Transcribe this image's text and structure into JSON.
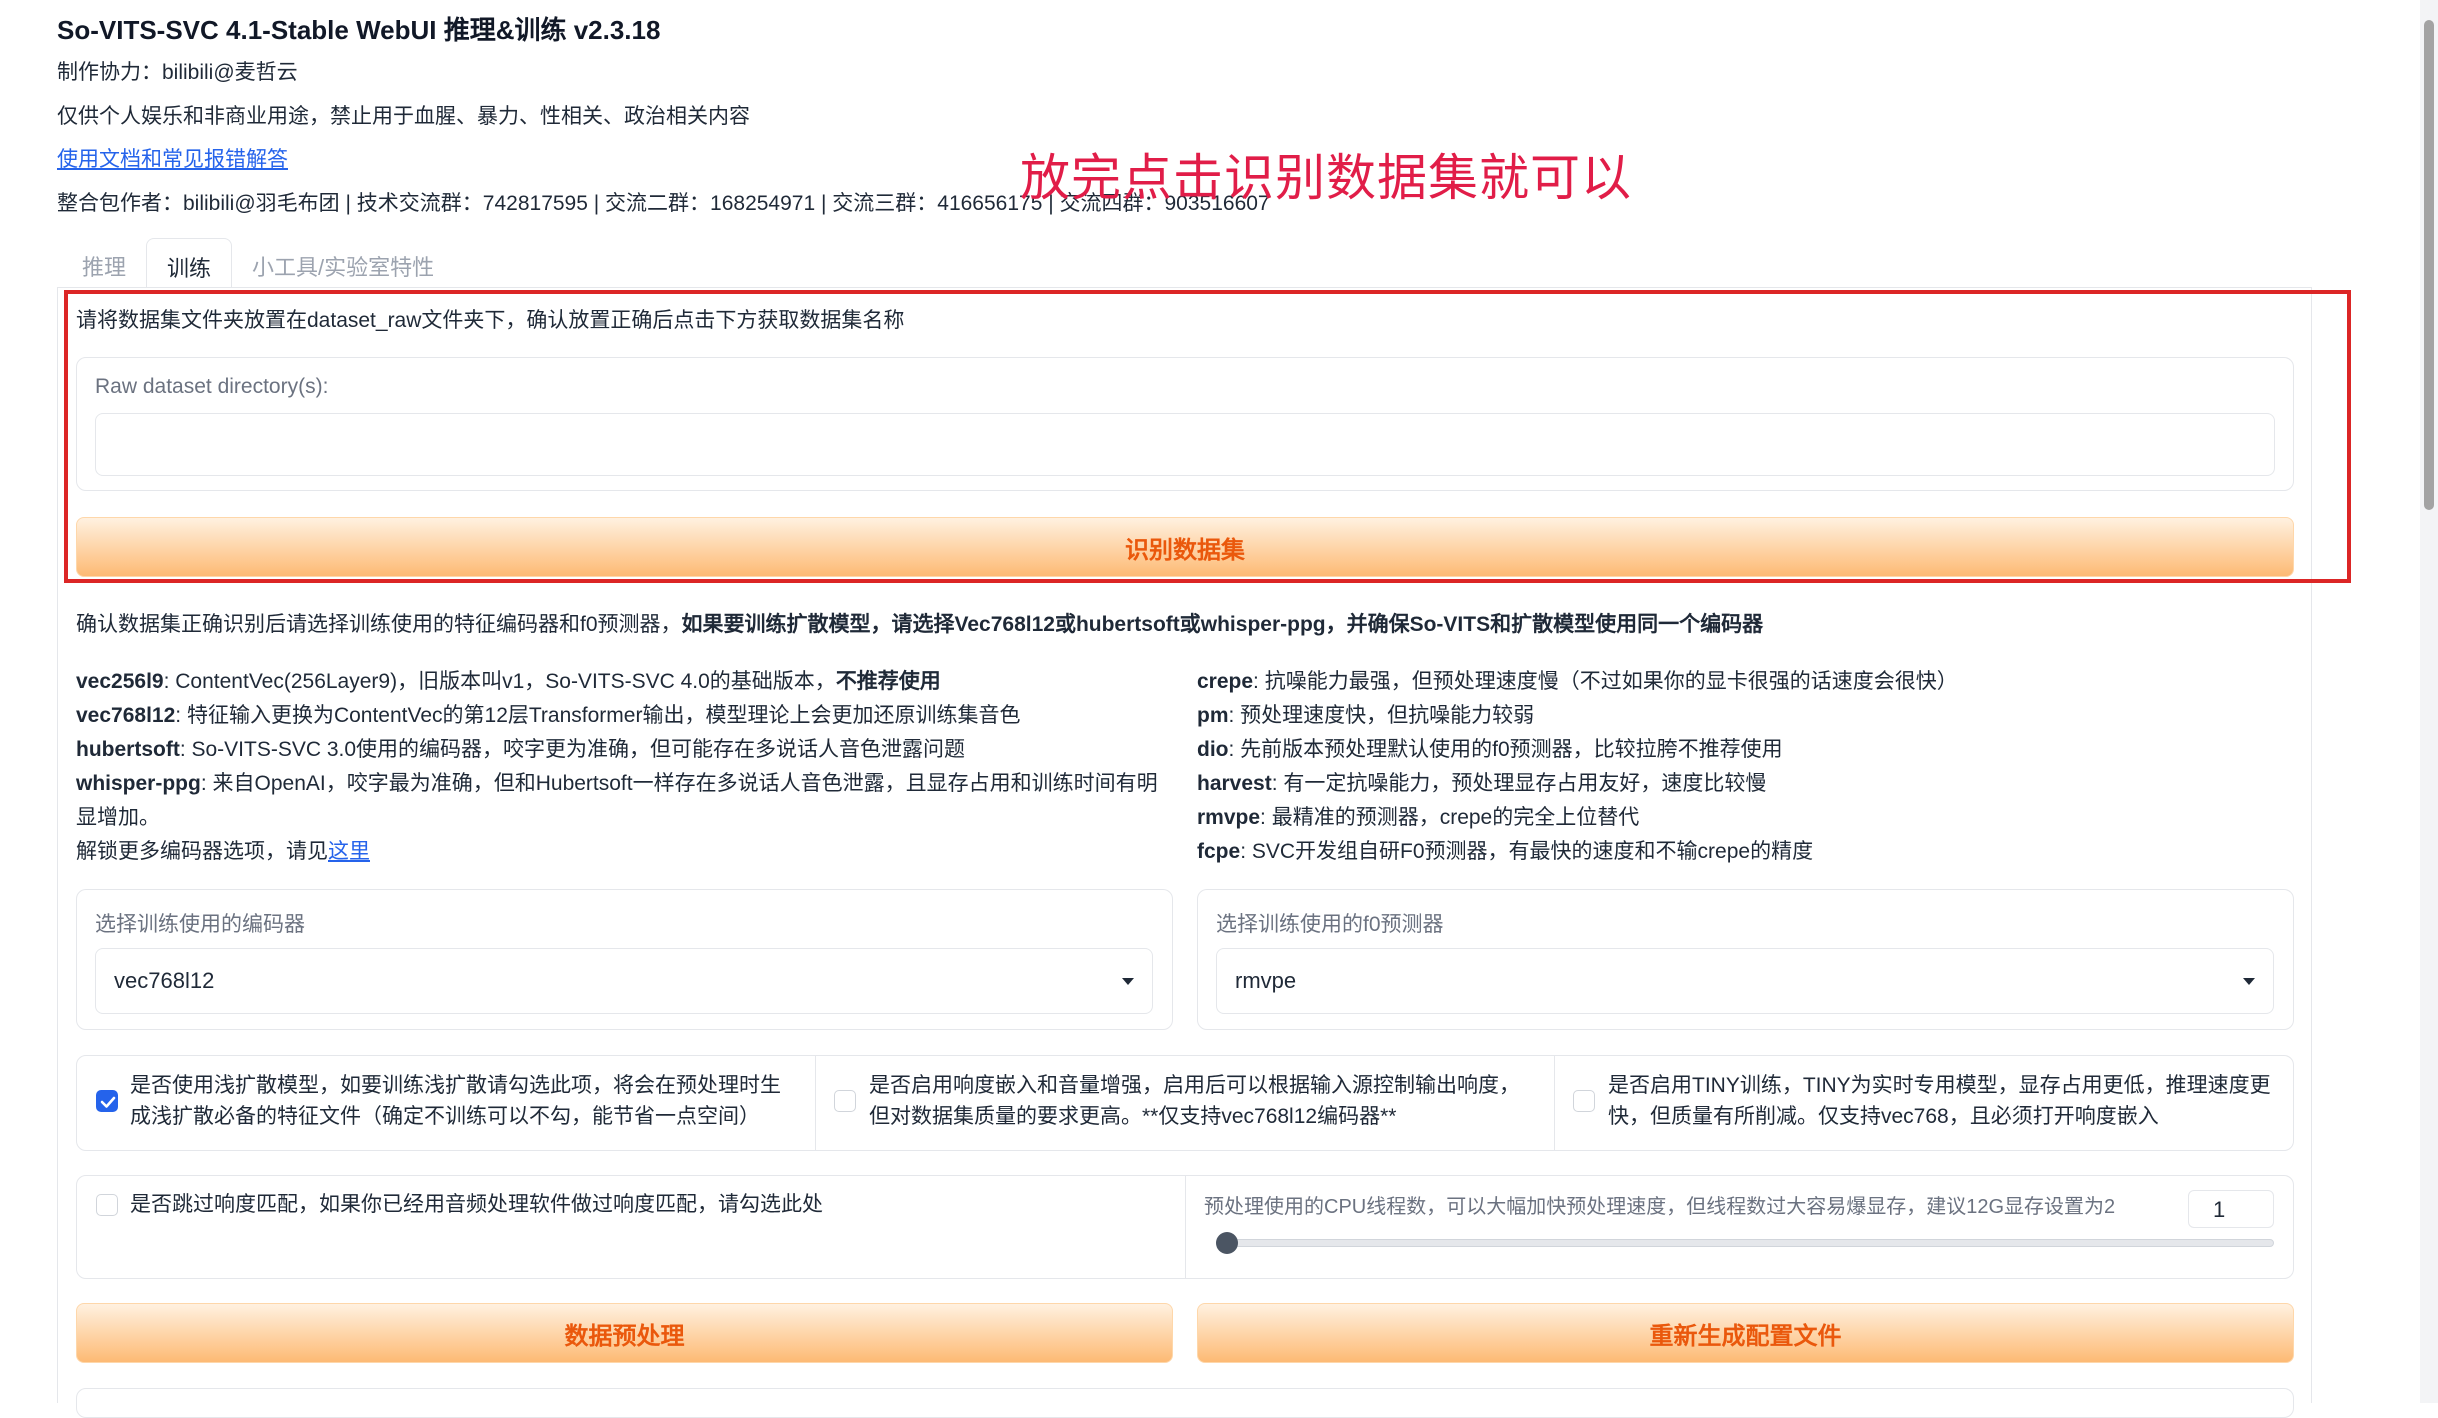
{
  "header": {
    "title": "So-VITS-SVC 4.1-Stable WebUI 推理&训练 v2.3.18",
    "credit": "制作协力：bilibili@麦哲云",
    "notice": "仅供个人娱乐和非商业用途，禁止用于血腥、暴力、性相关、政治相关内容",
    "docs_link": "使用文档和常见报错解答",
    "authors": "整合包作者：bilibili@羽毛布团 | 技术交流群：742817595 | 交流二群：168254971 | 交流三群：416656175 | 交流四群：903516607"
  },
  "annotation": "放完点击识别数据集就可以",
  "tabs": [
    {
      "label": "推理"
    },
    {
      "label": "训练"
    },
    {
      "label": "小工具/实验室特性"
    }
  ],
  "dataset": {
    "instruction": "请将数据集文件夹放置在dataset_raw文件夹下，确认放置正确后点击下方获取数据集名称",
    "raw_label": "Raw dataset directory(s):",
    "raw_value": "",
    "identify_button": "识别数据集"
  },
  "encoder_intro": {
    "normal": "确认数据集正确识别后请选择训练使用的特征编码器和f0预测器，",
    "bold": "如果要训练扩散模型，请选择Vec768l12或hubertsoft或whisper-ppg，并确保So-VITS和扩散模型使用同一个编码器"
  },
  "encoders": [
    {
      "name": "vec256l9",
      "desc": ": ContentVec(256Layer9)，旧版本叫v1，So-VITS-SVC 4.0的基础版本，",
      "strong": "不推荐使用"
    },
    {
      "name": "vec768l12",
      "desc": ": 特征输入更换为ContentVec的第12层Transformer输出，模型理论上会更加还原训练集音色",
      "strong": ""
    },
    {
      "name": "hubertsoft",
      "desc": ": So-VITS-SVC 3.0使用的编码器，咬字更为准确，但可能存在多说话人音色泄露问题",
      "strong": ""
    },
    {
      "name": "whisper-ppg",
      "desc": ": 来自OpenAI，咬字最为准确，但和Hubertsoft一样存在多说话人音色泄露，且显存占用和训练时间有明显增加。",
      "strong": ""
    }
  ],
  "unlock_text": "解锁更多编码器选项，请见",
  "unlock_link": "这里",
  "f0_predictors": [
    {
      "name": "crepe",
      "desc": ": 抗噪能力最强，但预处理速度慢（不过如果你的显卡很强的话速度会很快）"
    },
    {
      "name": "pm",
      "desc": ": 预处理速度快，但抗噪能力较弱"
    },
    {
      "name": "dio",
      "desc": ": 先前版本预处理默认使用的f0预测器，比较拉胯不推荐使用"
    },
    {
      "name": "harvest",
      "desc": ": 有一定抗噪能力，预处理显存占用友好，速度比较慢"
    },
    {
      "name": "rmvpe",
      "desc": ": 最精准的预测器，crepe的完全上位替代"
    },
    {
      "name": "fcpe",
      "desc": ": SVC开发组自研F0预测器，有最快的速度和不输crepe的精度"
    }
  ],
  "encoder_select": {
    "label": "选择训练使用的编码器",
    "value": "vec768l12"
  },
  "f0_select": {
    "label": "选择训练使用的f0预测器",
    "value": "rmvpe"
  },
  "checkboxes": {
    "shallow_diffusion": {
      "line1": "是否使用浅扩散模型，如要训练浅扩散请勾选此项，将会在预处理时生",
      "line2": "成浅扩散必备的特征文件（确定不训练可以不勾，能节省一点空间）",
      "checked": true
    },
    "loudness_embed": {
      "line1": "是否启用响度嵌入和音量增强，启用后可以根据输入源控制输出响度，",
      "line2": "但对数据集质量的要求更高。**仅支持vec768l12编码器**",
      "checked": false
    },
    "tiny": {
      "line1": "是否启用TINY训练，TINY为实时专用模型，显存占用更低，推理速度更",
      "line2": "快，但质量有所削减。仅支持vec768，且必须打开响度嵌入",
      "checked": false
    },
    "skip_loudness": {
      "line1": "是否跳过响度匹配，如果你已经用音频处理软件做过响度匹配，请勾选此处",
      "checked": false
    }
  },
  "cpu_threads": {
    "label": "预处理使用的CPU线程数，可以大幅加快预处理速度，但线程数过大容易爆显存，建议12G显存设置为2",
    "value": "1",
    "fraction": 0.0
  },
  "buttons": {
    "preprocess": "数据预处理",
    "regen_config": "重新生成配置文件"
  }
}
